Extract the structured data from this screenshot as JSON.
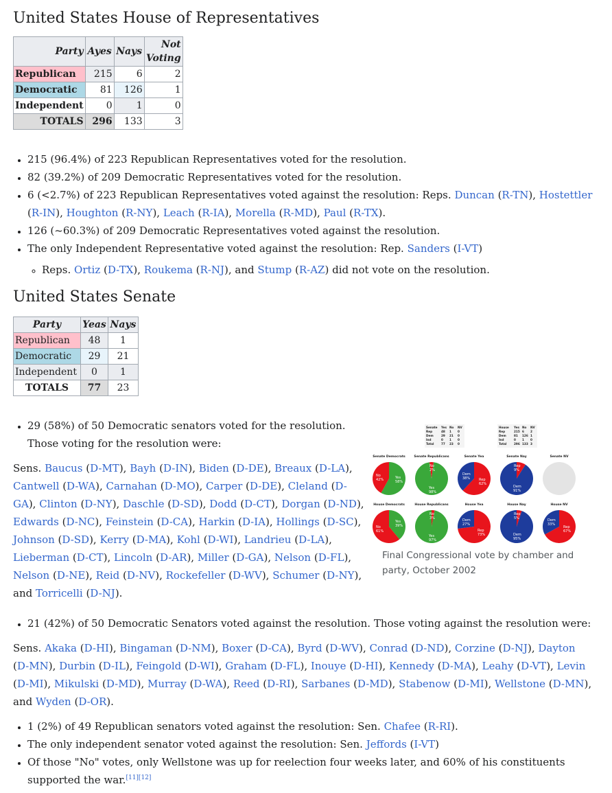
{
  "house": {
    "heading": "United States House of Representatives",
    "headers": [
      "Party",
      "Ayes",
      "Nays",
      "Not Voting"
    ],
    "rows": [
      {
        "party": "Republican",
        "ayes": "215",
        "nays": "6",
        "nv": "2"
      },
      {
        "party": "Democratic",
        "ayes": "81",
        "nays": "126",
        "nv": "1"
      },
      {
        "party": "Independent",
        "ayes": "0",
        "nays": "1",
        "nv": "0"
      }
    ],
    "totals": {
      "label": "TOTALS",
      "ayes": "296",
      "nays": "133",
      "nv": "3"
    }
  },
  "house_bullets": {
    "b1": "215 (96.4%) of 223 Republican Representatives voted for the resolution.",
    "b2": "82 (39.2%) of 209 Democratic Representatives voted for the resolution.",
    "b3_prefix": "6 (<2.7%) of 223 Republican Representatives voted against the resolution: Reps.",
    "b4": "126 (~60.3%) of 209 Democratic Representatives voted against the resolution.",
    "b5_prefix": "The only Independent Representative voted against the resolution: Rep.",
    "sub_prefix": "Reps.",
    "sub_suffix": "did not vote on the resolution."
  },
  "senate": {
    "heading": "United States Senate",
    "headers": [
      "Party",
      "Yeas",
      "Nays"
    ],
    "rows": [
      {
        "party": "Republican",
        "yeas": "48",
        "nays": "1"
      },
      {
        "party": "Democratic",
        "yeas": "29",
        "nays": "21"
      },
      {
        "party": "Independent",
        "yeas": "0",
        "nays": "1"
      }
    ],
    "totals": {
      "label": "TOTALS",
      "yeas": "77",
      "nays": "23"
    }
  },
  "senate_text": {
    "b1_line1": "29 (58%) of 50 Democratic senators voted for the resolution.",
    "b1_line2": "Those voting for the resolution were:",
    "b2": "21 (42%) of 50 Democratic Senators voted against the resolution. Those voting against the resolution were:",
    "b3_prefix": "1 (2%) of 49 Republican senators voted against the resolution: Sen.",
    "b4_prefix": "The only independent senator voted against the resolution: Sen.",
    "b5": "Of those \"No\" votes, only Wellstone was up for reelection four weeks later, and 60% of his constituents supported the war.",
    "refs": "[11][12]"
  },
  "figure": {
    "caption": "Final Congressional vote by chamber and party, October 2002",
    "mini_senate": {
      "h": [
        "Senate",
        "Yes",
        "No",
        "NV"
      ],
      "r": [
        [
          "Rep",
          "48",
          "1",
          "0"
        ],
        [
          "Dem",
          "29",
          "21",
          "0"
        ],
        [
          "Ind",
          "0",
          "1",
          "0"
        ],
        [
          "Total",
          "77",
          "23",
          "0"
        ]
      ]
    },
    "mini_house": {
      "h": [
        "House",
        "Yes",
        "No",
        "NV"
      ],
      "r": [
        [
          "Rep",
          "215",
          "6",
          "2"
        ],
        [
          "Dem",
          "81",
          "126",
          "1"
        ],
        [
          "Ind",
          "0",
          "1",
          "0"
        ],
        [
          "Total",
          "296",
          "133",
          "3"
        ]
      ]
    },
    "row1_titles": [
      "Senate Democrats",
      "Senate Republicans",
      "Senate Yea",
      "Senate Nay",
      "Senate NV"
    ],
    "row2_titles": [
      "House Democrats",
      "House Republicans",
      "House Yea",
      "House Nay",
      "House NV"
    ],
    "colors": {
      "red": "#e8141c",
      "green": "#3aa83a",
      "blue": "#1e3c9c",
      "grey": "#e4e4e4"
    }
  }
}
